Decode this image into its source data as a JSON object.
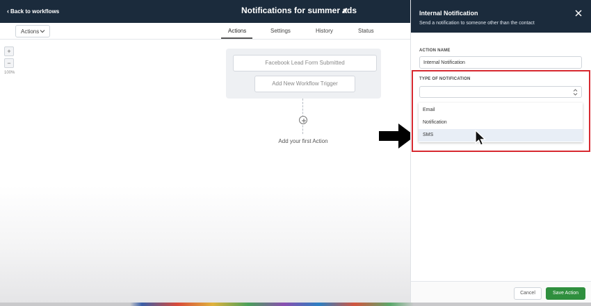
{
  "topbar": {
    "back_label": "Back to workflows",
    "title": "Notifications for summer ads",
    "edit_icon": "pencil-icon"
  },
  "subbar": {
    "actions_dropdown": "Actions",
    "tabs": [
      {
        "label": "Actions",
        "active": true
      },
      {
        "label": "Settings",
        "active": false
      },
      {
        "label": "History",
        "active": false
      },
      {
        "label": "Status",
        "active": false
      }
    ]
  },
  "canvas": {
    "zoom_in": "+",
    "zoom_out": "−",
    "zoom_level": "100%",
    "trigger_existing": "Facebook Lead Form Submitted",
    "add_trigger": "Add New Workflow Trigger",
    "add_first_action": "Add your first Action"
  },
  "panel": {
    "title": "Internal Notification",
    "subtitle": "Send a notification to someone other than the contact",
    "action_name_label": "ACTION NAME",
    "action_name_value": "Internal Notification",
    "type_label": "TYPE OF NOTIFICATION",
    "type_value": "",
    "options": [
      "Email",
      "Notification",
      "SMS"
    ],
    "hovered_option": "SMS",
    "cancel_label": "Cancel",
    "save_label": "Save Action"
  },
  "colors": {
    "header_bg": "#1b2b3c",
    "highlight_border": "#d7282f",
    "save_button": "#2f8f3e"
  }
}
